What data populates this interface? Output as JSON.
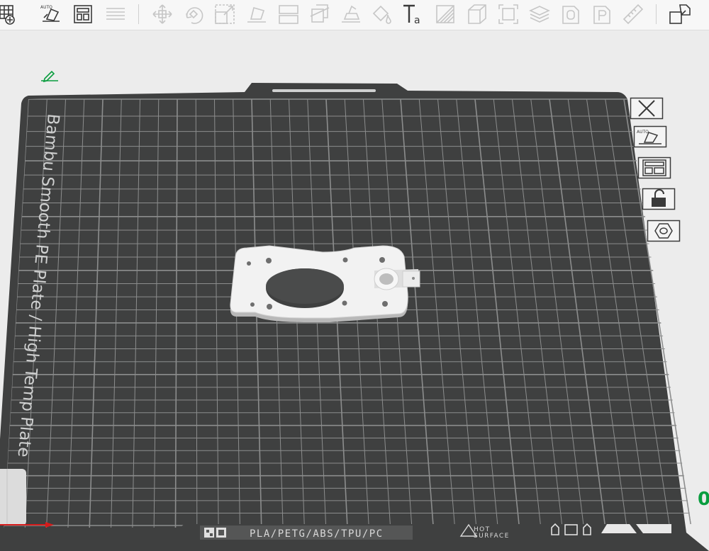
{
  "toolbar": {
    "items": [
      {
        "name": "add-plate-icon",
        "enabled": true
      },
      {
        "name": "auto-orient-icon",
        "enabled": true,
        "badge": "AUTO"
      },
      {
        "name": "arrange-icon",
        "enabled": true
      },
      {
        "name": "layers-menu-icon",
        "enabled": false
      },
      {
        "name": "move-icon",
        "enabled": false
      },
      {
        "name": "rotate-icon",
        "enabled": false
      },
      {
        "name": "scale-icon",
        "enabled": false
      },
      {
        "name": "lay-on-face-icon",
        "enabled": false
      },
      {
        "name": "split-icon",
        "enabled": false
      },
      {
        "name": "cut-icon",
        "enabled": false
      },
      {
        "name": "support-paint-icon",
        "enabled": false
      },
      {
        "name": "seam-paint-icon",
        "enabled": false
      },
      {
        "name": "text-icon",
        "enabled": false,
        "glyph": "Ta"
      },
      {
        "name": "measure-icon",
        "enabled": false
      },
      {
        "name": "cube-icon",
        "enabled": false
      },
      {
        "name": "fit-icon",
        "enabled": false
      },
      {
        "name": "stack-icon",
        "enabled": false
      },
      {
        "name": "object-o-icon",
        "enabled": false,
        "glyph": "O"
      },
      {
        "name": "object-p-icon",
        "enabled": false,
        "glyph": "P"
      },
      {
        "name": "ruler-icon",
        "enabled": false
      },
      {
        "name": "assembly-icon",
        "enabled": true
      }
    ]
  },
  "plate": {
    "label": "Bambu Smooth PE Plate / High Temp Plate",
    "bottom_bar": {
      "filaments": "PLA/PETG/ABS/TPU/PC",
      "warning_line1": "HOT",
      "warning_line2": "SURFACE"
    }
  },
  "side_toolbar": [
    {
      "name": "close-plate-button",
      "icon": "close-icon"
    },
    {
      "name": "auto-orient-plate-button",
      "icon": "auto-orient-icon",
      "badge": "AUTO"
    },
    {
      "name": "arrange-plate-button",
      "icon": "arrange-icon"
    },
    {
      "name": "lock-plate-button",
      "icon": "unlock-icon"
    },
    {
      "name": "plate-settings-button",
      "icon": "hexagon-nut-icon"
    }
  ],
  "corner_glyph": "0",
  "colors": {
    "plate": "#3f4040",
    "grid": "#8c8d8d",
    "model": "#f2f2f2",
    "accent": "#0a9d3f",
    "x_axis": "#d61b1b"
  }
}
